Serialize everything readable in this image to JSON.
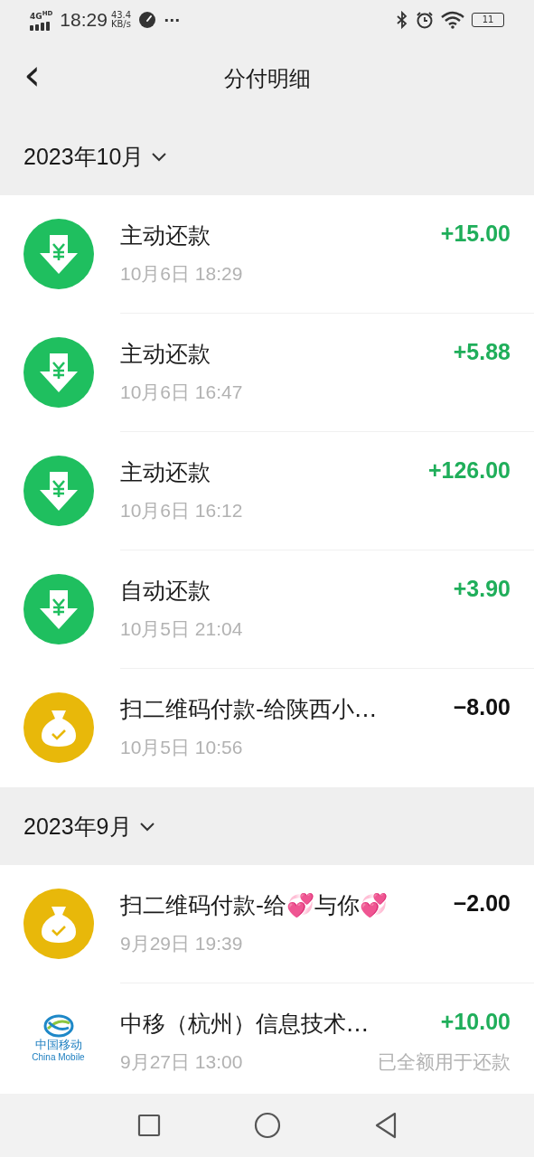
{
  "status_bar": {
    "network": "4G",
    "network_badge": "HD",
    "time": "18:29",
    "speed": "43.4",
    "speed_unit": "KB/s",
    "more": "···",
    "battery": "11"
  },
  "header": {
    "back": "‹",
    "title": "分付明细"
  },
  "months": [
    {
      "label": "2023年10月",
      "items": [
        {
          "kind": "repay",
          "title": "主动还款",
          "date": "10月6日 18:29",
          "amount": "+15.00",
          "income": true
        },
        {
          "kind": "repay",
          "title": "主动还款",
          "date": "10月6日 16:47",
          "amount": "+5.88",
          "income": true
        },
        {
          "kind": "repay",
          "title": "主动还款",
          "date": "10月6日 16:12",
          "amount": "+126.00",
          "income": true
        },
        {
          "kind": "repay",
          "title": "自动还款",
          "date": "10月5日 21:04",
          "amount": "+3.90",
          "income": true
        },
        {
          "kind": "pay",
          "title": "扫二维码付款-给陕西小…",
          "date": "10月5日 10:56",
          "amount": "−8.00",
          "income": false
        }
      ]
    },
    {
      "label": "2023年9月",
      "items": [
        {
          "kind": "pay",
          "title": "扫二维码付款-给💞与你💞",
          "date": "9月29日 19:39",
          "amount": "−2.00",
          "income": false
        },
        {
          "kind": "merchant",
          "logo_name": "中国移动",
          "logo_name_en": "China Mobile",
          "title": "中移（杭州）信息技术…",
          "date": "9月27日 13:00",
          "amount": "+10.00",
          "income": true,
          "note": "已全额用于还款"
        }
      ]
    }
  ]
}
